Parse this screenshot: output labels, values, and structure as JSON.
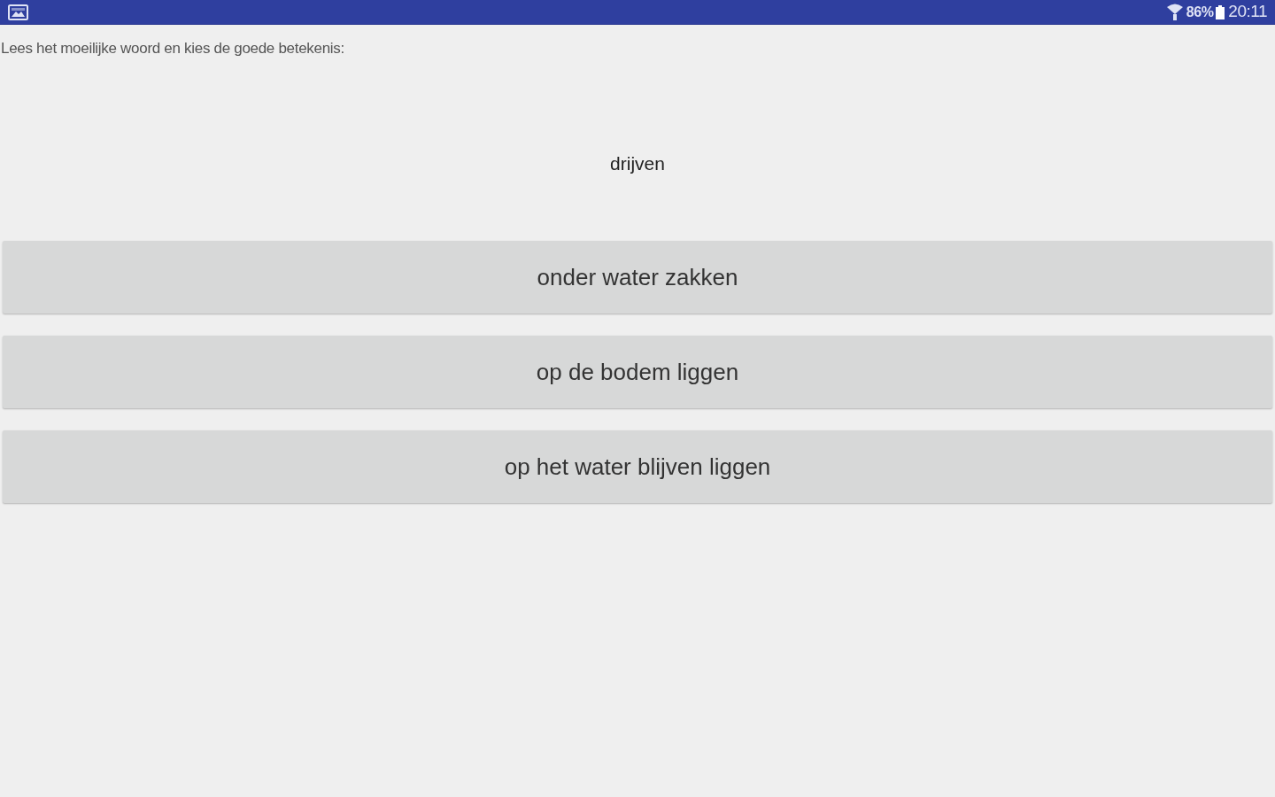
{
  "status_bar": {
    "battery": "86%",
    "time": "20:11"
  },
  "instruction": "Lees het moeilijke woord en kies de goede betekenis:",
  "word": "drijven",
  "options": [
    {
      "label": "onder water zakken"
    },
    {
      "label": "op de bodem liggen"
    },
    {
      "label": "op het water blijven liggen"
    }
  ]
}
